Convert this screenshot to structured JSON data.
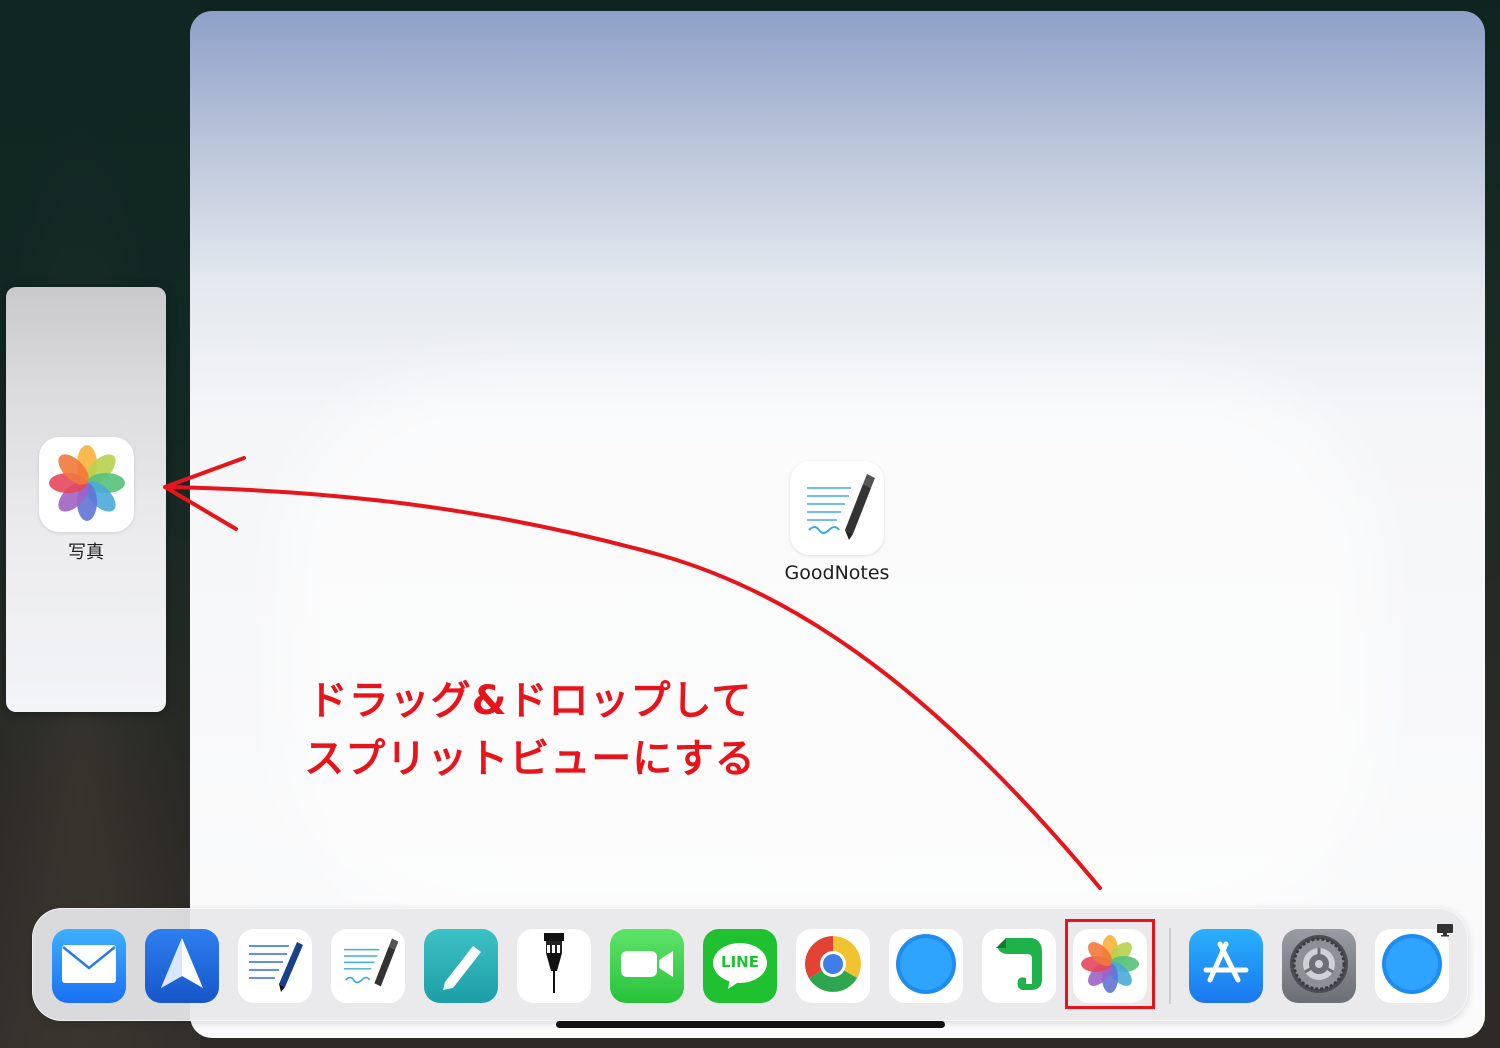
{
  "slideover": {
    "app_label": "写真",
    "app_icon": "photos-icon"
  },
  "main_app": {
    "label": "GoodNotes",
    "icon": "goodnotes-icon"
  },
  "annotation": {
    "line1": "ドラッグ&ドロップして",
    "line2": "スプリットビューにする",
    "color": "#e8141b"
  },
  "dock": {
    "apps": [
      {
        "name": "mail",
        "icon": "mail-icon"
      },
      {
        "name": "spark",
        "icon": "spark-icon"
      },
      {
        "name": "notes-writer",
        "icon": "notes-writer-icon"
      },
      {
        "name": "goodnotes",
        "icon": "goodnotes-icon"
      },
      {
        "name": "pen-app",
        "icon": "pen-icon"
      },
      {
        "name": "pencil-app",
        "icon": "pencil-icon"
      },
      {
        "name": "facetime",
        "icon": "facetime-icon"
      },
      {
        "name": "line",
        "icon": "line-icon",
        "text": "LINE"
      },
      {
        "name": "chrome",
        "icon": "chrome-icon"
      },
      {
        "name": "safari",
        "icon": "safari-icon"
      },
      {
        "name": "evernote",
        "icon": "evernote-icon"
      },
      {
        "name": "photos",
        "icon": "photos-icon"
      },
      {
        "name": "app-store",
        "icon": "app-store-icon"
      },
      {
        "name": "settings",
        "icon": "settings-icon"
      },
      {
        "name": "safari-recent",
        "icon": "safari-icon"
      }
    ],
    "highlighted_app": "photos"
  }
}
